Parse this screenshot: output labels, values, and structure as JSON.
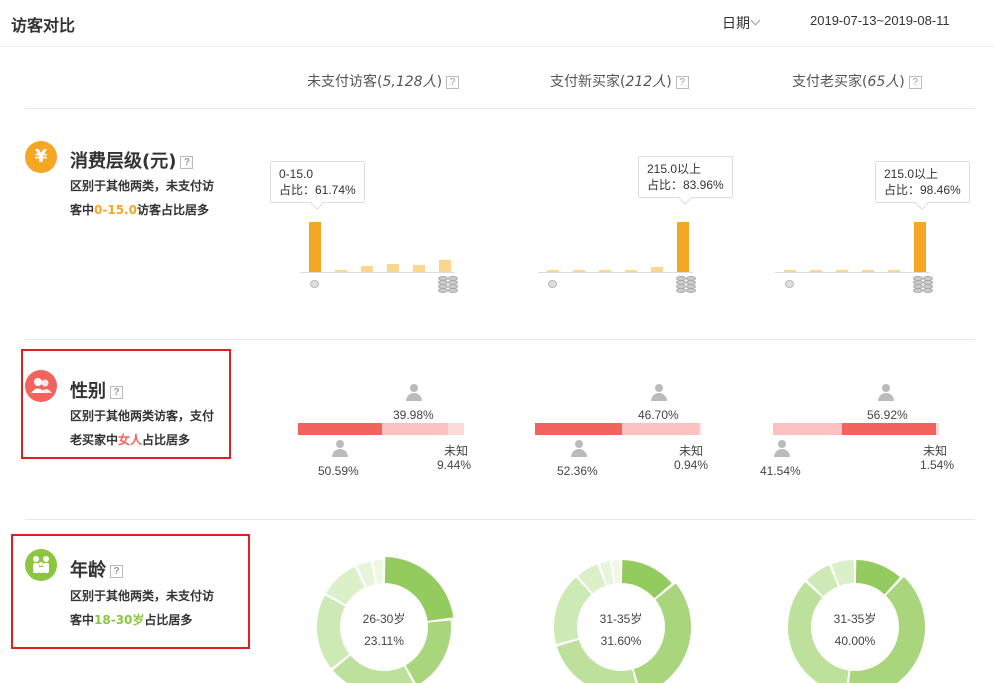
{
  "header": {
    "title": "访客对比",
    "date_label": "日期",
    "date_range": "2019-07-13~2019-08-11"
  },
  "columns": [
    {
      "label": "未支付访客(",
      "count": "5,128人",
      "close": ")",
      "help": "?"
    },
    {
      "label": "支付新买家(",
      "count": "212人",
      "close": ")",
      "help": "?"
    },
    {
      "label": "支付老买家(",
      "count": "65人",
      "close": ")",
      "help": "?"
    }
  ],
  "sections": {
    "spend": {
      "icon": "¥",
      "icon_color": "#f5a623",
      "title": "消费层级(元)",
      "help": "?",
      "desc_pre": "区别于其他两类，未支付访客中",
      "desc_hl": "0-15.0",
      "desc_post": "访客占比居多",
      "charts": [
        {
          "tooltip_range": "0-15.0",
          "tooltip_share": "占比：61.74%",
          "values": [
            61.74,
            3,
            7,
            10,
            9,
            15
          ]
        },
        {
          "tooltip_range": "215.0以上",
          "tooltip_share": "占比：83.96%",
          "values": [
            2,
            1,
            1,
            4,
            8,
            83.96
          ]
        },
        {
          "tooltip_range": "215.0以上",
          "tooltip_share": "占比：98.46%",
          "values": [
            0.5,
            0.5,
            0.3,
            0.3,
            0.4,
            98.46
          ]
        }
      ],
      "highlight_color": "#f5a623",
      "muted_color": "#fbd68f"
    },
    "gender": {
      "icon_name": "people-icon",
      "icon_color": "#f2635f",
      "title": "性别",
      "help": "?",
      "desc_pre": "区别于其他两类访客，支付老买家中",
      "desc_hl": "女人",
      "desc_post": "占比居多",
      "unknown_label": "未知",
      "charts": [
        {
          "female": "39.98%",
          "male": "50.59%",
          "unknown": "9.44%",
          "female_v": 39.98,
          "male_v": 50.59,
          "unknown_v": 9.44,
          "dominant": "male"
        },
        {
          "female": "46.70%",
          "male": "52.36%",
          "unknown": "0.94%",
          "female_v": 46.7,
          "male_v": 52.36,
          "unknown_v": 0.94,
          "dominant": "male"
        },
        {
          "female": "56.92%",
          "male": "41.54%",
          "unknown": "1.54%",
          "female_v": 56.92,
          "male_v": 41.54,
          "unknown_v": 1.54,
          "dominant": "female"
        }
      ],
      "strong_color": "#f2635f",
      "light_color": "#f9c2c0"
    },
    "age": {
      "icon_name": "family-icon",
      "icon_color": "#8cc63f",
      "title": "年龄",
      "help": "?",
      "desc_pre": "区别于其他两类，未支付访客中",
      "desc_hl": "18-30岁",
      "desc_post": "占比居多",
      "charts": [
        {
          "center_label": "26-30岁",
          "center_value": "23.11%",
          "slices": [
            23.11,
            19,
            22,
            19,
            10,
            4,
            2.89
          ]
        },
        {
          "center_label": "31-35岁",
          "center_value": "31.60%",
          "slices": [
            14,
            31.6,
            25,
            18,
            6,
            3,
            2.4
          ]
        },
        {
          "center_label": "31-35岁",
          "center_value": "40.00%",
          "slices": [
            12,
            40.0,
            35,
            7,
            6
          ]
        }
      ],
      "colors": [
        "#93cb5f",
        "#a9d57c",
        "#bde19c",
        "#cde9b5",
        "#dbefc9",
        "#e6f4d9",
        "#eef8e5"
      ]
    }
  }
}
